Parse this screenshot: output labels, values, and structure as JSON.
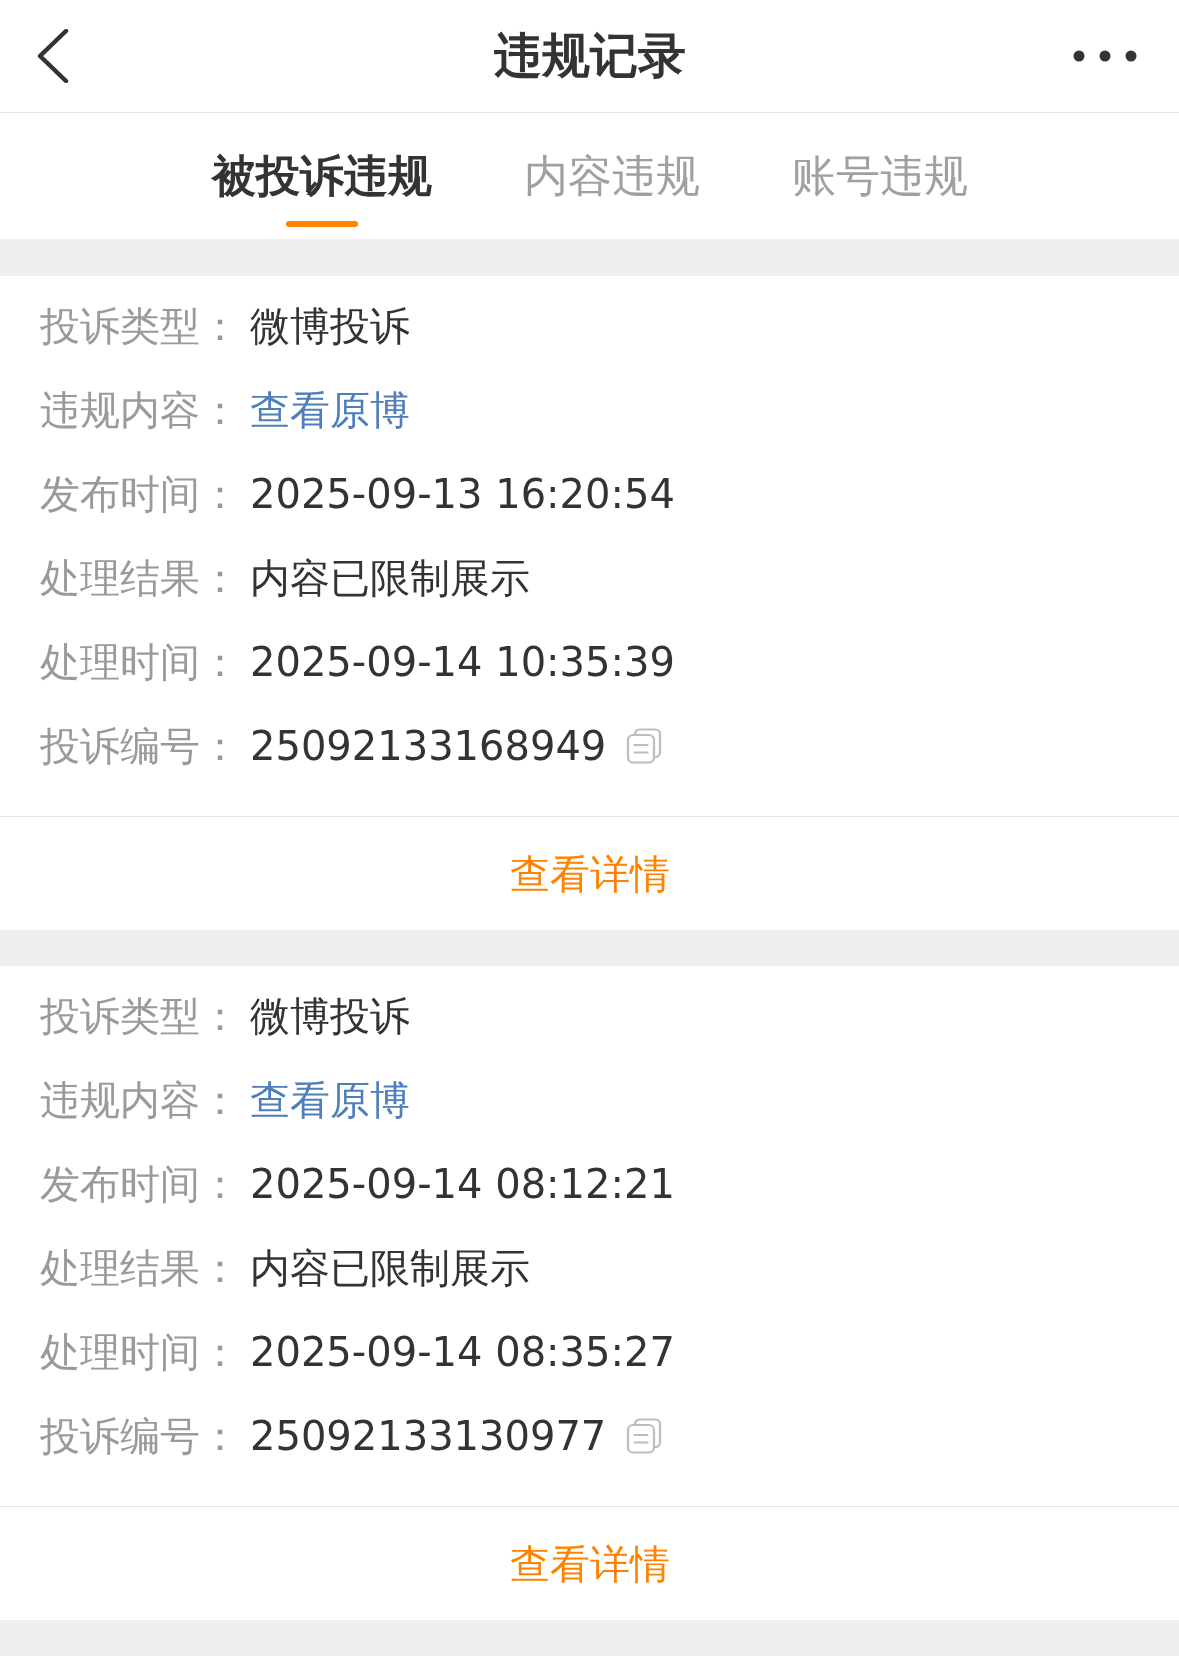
{
  "header": {
    "title": "违规记录"
  },
  "tabs": [
    {
      "label": "被投诉违规",
      "selected": true
    },
    {
      "label": "内容违规",
      "selected": false
    },
    {
      "label": "账号违规",
      "selected": false
    }
  ],
  "records": [
    {
      "fields": [
        {
          "kind": "text",
          "label": "投诉类型：",
          "value": "微博投诉"
        },
        {
          "kind": "link",
          "label": "违规内容：",
          "value": "查看原博"
        },
        {
          "kind": "text",
          "label": "发布时间：",
          "value": "2025-09-13 16:20:54"
        },
        {
          "kind": "text",
          "label": "处理结果：",
          "value": "内容已限制展示"
        },
        {
          "kind": "text",
          "label": "处理时间：",
          "value": "2025-09-14 10:35:39"
        },
        {
          "kind": "copyable",
          "label": "投诉编号：",
          "value": "25092133168949"
        }
      ],
      "action": "查看详情"
    },
    {
      "fields": [
        {
          "kind": "text",
          "label": "投诉类型：",
          "value": "微博投诉"
        },
        {
          "kind": "link",
          "label": "违规内容：",
          "value": "查看原博"
        },
        {
          "kind": "text",
          "label": "发布时间：",
          "value": "2025-09-14 08:12:21"
        },
        {
          "kind": "text",
          "label": "处理结果：",
          "value": "内容已限制展示"
        },
        {
          "kind": "text",
          "label": "处理时间：",
          "value": "2025-09-14 08:35:27"
        },
        {
          "kind": "copyable",
          "label": "投诉编号：",
          "value": "25092133130977"
        }
      ],
      "action": "查看详情"
    }
  ]
}
